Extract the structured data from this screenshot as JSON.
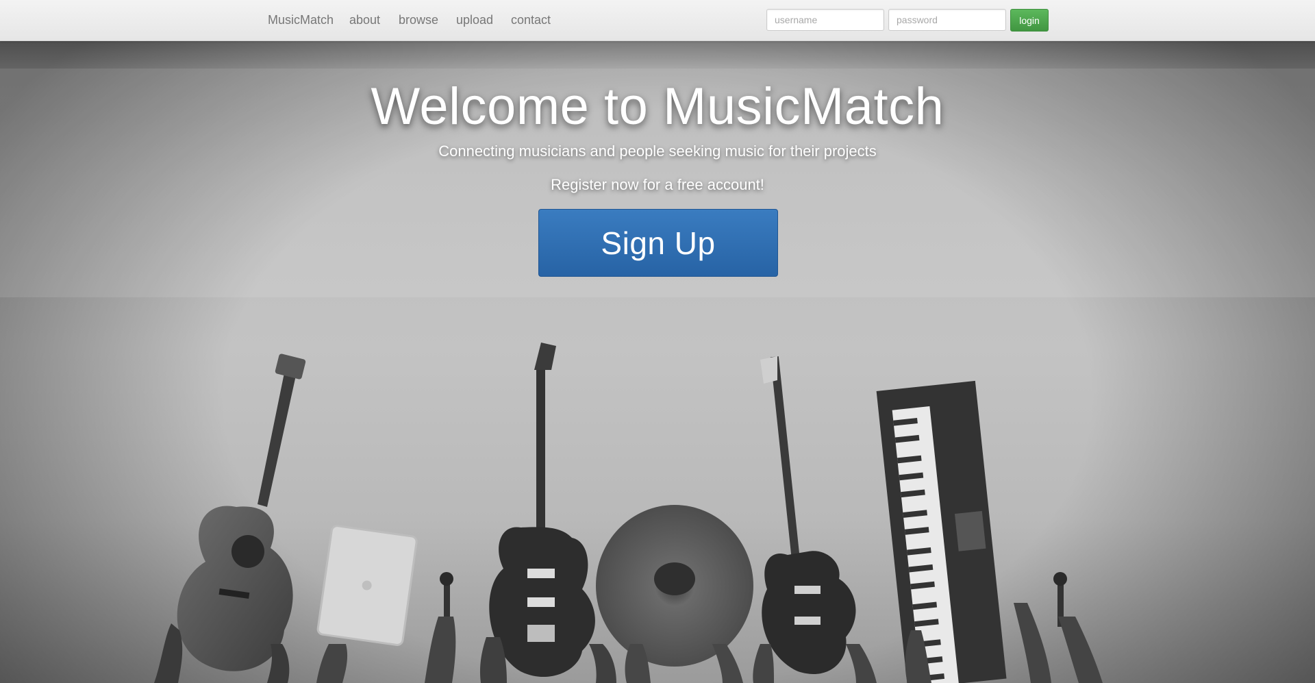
{
  "navbar": {
    "brand": "MusicMatch",
    "links": [
      "about",
      "browse",
      "upload",
      "contact"
    ],
    "username_placeholder": "username",
    "password_placeholder": "password",
    "login_label": "login"
  },
  "hero": {
    "title": "Welcome to MusicMatch",
    "subtitle": "Connecting musicians and people seeking music for their projects",
    "register_text": "Register now for a free account!",
    "signup_label": "Sign Up"
  },
  "colors": {
    "login_green": "#5cb85c",
    "signup_blue": "#2f6eb2"
  },
  "background_image": {
    "icons": [
      "acoustic-guitar-icon",
      "tablet-icon",
      "microphone-icon",
      "electric-guitar-icon",
      "cymbal-icon",
      "bass-guitar-icon",
      "keyboard-icon",
      "hand-icon"
    ]
  }
}
